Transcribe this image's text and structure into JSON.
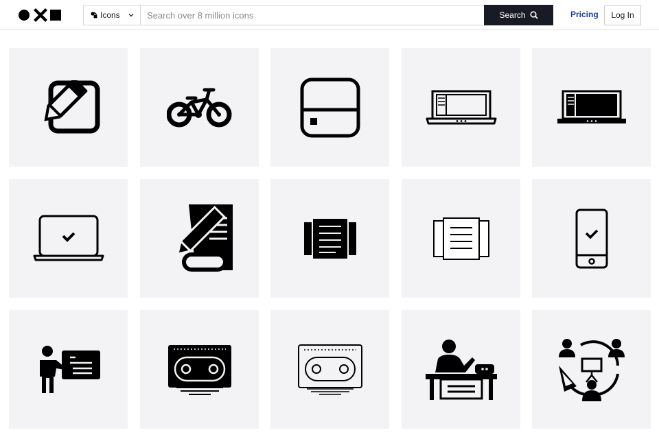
{
  "header": {
    "logo_icon": "noun-project-logo-icon",
    "search": {
      "type_label": "Icons",
      "placeholder": "Search over 8 million icons",
      "value": "",
      "button_label": "Search"
    },
    "pricing_label": "Pricing",
    "login_label": "Log In"
  },
  "colors": {
    "search_button_bg": "#181b25",
    "pricing_link": "#1c3b9e",
    "tile_bg": "#f3f3f5",
    "icon": "#000000"
  },
  "icons": [
    {
      "name": "edit-icon"
    },
    {
      "name": "bicycle-icon"
    },
    {
      "name": "hard-drive-icon"
    },
    {
      "name": "laptop-outline-icon"
    },
    {
      "name": "laptop-filled-icon"
    },
    {
      "name": "laptop-check-icon"
    },
    {
      "name": "pencil-document-scroll-icon"
    },
    {
      "name": "document-pages-filled-icon"
    },
    {
      "name": "document-pages-outline-icon"
    },
    {
      "name": "smartphone-check-icon"
    },
    {
      "name": "presenter-board-icon"
    },
    {
      "name": "cassette-tape-filled-icon"
    },
    {
      "name": "cassette-tape-outline-icon"
    },
    {
      "name": "teacher-desk-icon"
    },
    {
      "name": "meeting-cycle-icon"
    }
  ]
}
